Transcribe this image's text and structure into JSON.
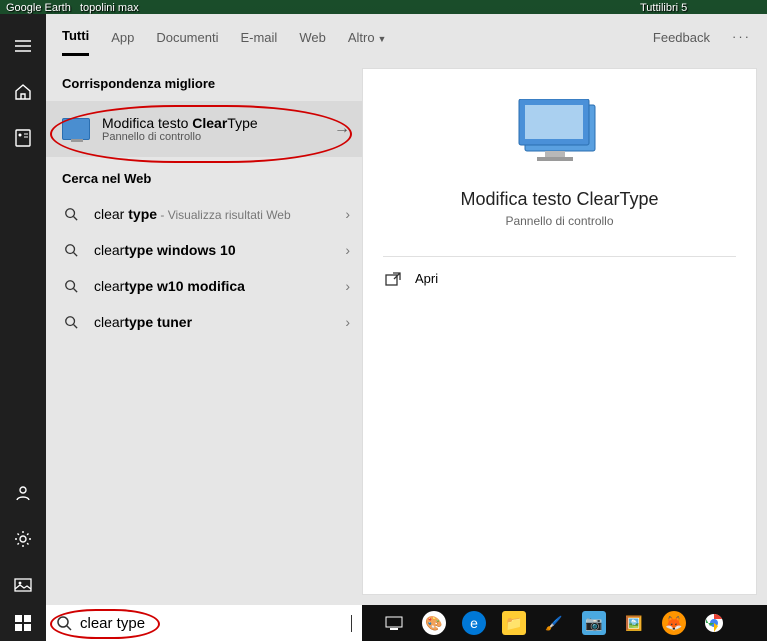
{
  "desktop": {
    "icon_labels": [
      "Google Earth",
      "topolini max",
      "Tuttilibri 5"
    ]
  },
  "tabs": {
    "items": [
      "Tutti",
      "App",
      "Documenti",
      "E-mail",
      "Web",
      "Altro"
    ],
    "feedback": "Feedback"
  },
  "sections": {
    "best_header": "Corrispondenza migliore",
    "web_header": "Cerca nel Web"
  },
  "best_match": {
    "title_pre": "Modifica testo ",
    "title_bold": "Clear",
    "title_post": "Type",
    "subtitle": "Pannello di controllo"
  },
  "web_results": [
    {
      "pre": "clear",
      "bold": " type",
      "post": "",
      "hint": " - Visualizza risultati Web"
    },
    {
      "pre": "clear",
      "bold": "type windows 10",
      "post": "",
      "hint": ""
    },
    {
      "pre": "clear",
      "bold": "type w10 modifica",
      "post": "",
      "hint": ""
    },
    {
      "pre": "clear",
      "bold": "type tuner",
      "post": "",
      "hint": ""
    }
  ],
  "preview": {
    "title": "Modifica testo ClearType",
    "subtitle": "Pannello di controllo",
    "action_open": "Apri"
  },
  "search": {
    "value": "clear type"
  }
}
